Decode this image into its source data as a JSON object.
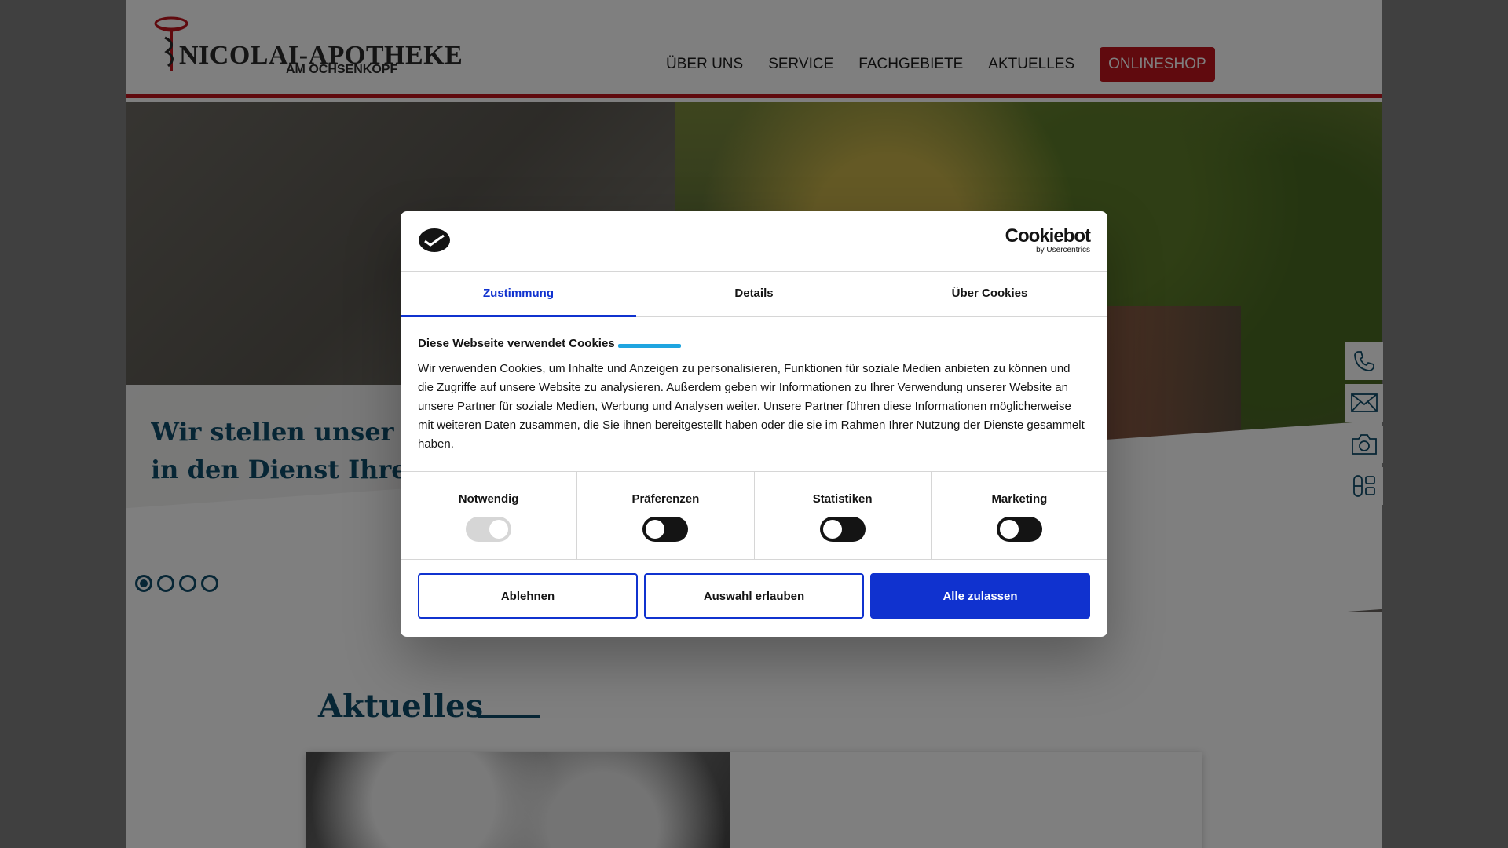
{
  "site": {
    "logo_name": "NICOLAI-APOTHEKE",
    "logo_sub": "AM OCHSENKOPF",
    "nav": [
      {
        "label": "ÜBER UNS"
      },
      {
        "label": "SERVICE"
      },
      {
        "label": "FACHGEBIETE"
      },
      {
        "label": "AKTUELLES"
      },
      {
        "label": "ONLINESHOP"
      }
    ],
    "hero": {
      "caption_line1": "Wir stellen unser W",
      "caption_line2": "in den Dienst Ihrer",
      "slides_total": 4,
      "slide_active": 1
    },
    "news_title": "Aktuelles",
    "side_icons": [
      "phone-icon",
      "mail-icon",
      "camera-icon",
      "pills-icon"
    ]
  },
  "cookie": {
    "brand_name": "Cookiebot",
    "brand_sub": "by Usercentrics",
    "tabs": [
      {
        "label": "Zustimmung"
      },
      {
        "label": "Details"
      },
      {
        "label": "Über Cookies"
      }
    ],
    "heading": "Diese Webseite verwendet Cookies",
    "body": "Wir verwenden Cookies, um Inhalte und Anzeigen zu personalisieren, Funktionen für soziale Medien anbieten zu können und die Zugriffe auf unsere Website zu analysieren. Außerdem geben wir Informationen zu Ihrer Verwendung unserer Website an unsere Partner für soziale Medien, Werbung und Analysen weiter. Unsere Partner führen diese Informationen möglicherweise mit weiteren Daten zusammen, die Sie ihnen bereitgestellt haben oder die sie im Rahmen Ihrer Nutzung der Dienste gesammelt haben.",
    "categories": [
      {
        "label": "Notwendig",
        "checked": true,
        "disabled": true
      },
      {
        "label": "Präferenzen",
        "checked": false
      },
      {
        "label": "Statistiken",
        "checked": false
      },
      {
        "label": "Marketing",
        "checked": false
      }
    ],
    "buttons": {
      "reject": "Ablehnen",
      "allow_selection": "Auswahl erlauben",
      "allow_all": "Alle zulassen"
    }
  },
  "colors": {
    "brand_red": "#c0151d",
    "brand_blue": "#0f4c6a",
    "cookiebot_blue": "#1032cf"
  }
}
